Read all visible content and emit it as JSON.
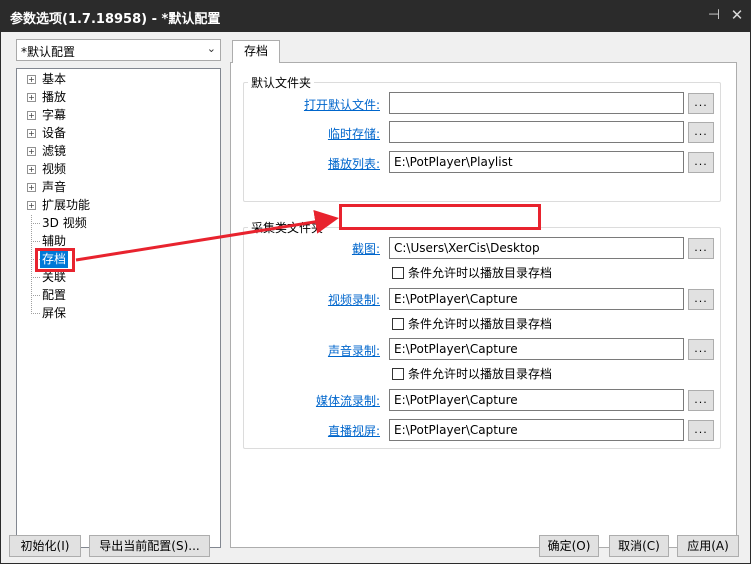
{
  "window": {
    "title": "参数选项(1.7.18958) - *默认配置",
    "pin_glyph": "⊣",
    "close_glyph": "✕"
  },
  "profile": {
    "selected": "*默认配置",
    "arrow_glyph": "⌄"
  },
  "tree": {
    "items": [
      {
        "label": "基本",
        "expandable": true
      },
      {
        "label": "播放",
        "expandable": true
      },
      {
        "label": "字幕",
        "expandable": true
      },
      {
        "label": "设备",
        "expandable": true
      },
      {
        "label": "滤镜",
        "expandable": true
      },
      {
        "label": "视频",
        "expandable": true
      },
      {
        "label": "声音",
        "expandable": true
      },
      {
        "label": "扩展功能",
        "expandable": true
      },
      {
        "label": "3D 视频",
        "expandable": false
      },
      {
        "label": "辅助",
        "expandable": false
      },
      {
        "label": "存档",
        "expandable": false,
        "selected": true
      },
      {
        "label": "关联",
        "expandable": false
      },
      {
        "label": "配置",
        "expandable": false
      },
      {
        "label": "屏保",
        "expandable": false
      }
    ],
    "expand_glyph": "+"
  },
  "tab": {
    "label": "存档"
  },
  "default_folders": {
    "title": "默认文件夹",
    "rows": [
      {
        "label": "打开默认文件:",
        "value": ""
      },
      {
        "label": "临时存储:",
        "value": ""
      },
      {
        "label": "播放列表:",
        "value": "E:\\PotPlayer\\Playlist"
      }
    ]
  },
  "capture_folders": {
    "title": "采集类文件夹",
    "rows": [
      {
        "label": "截图:",
        "value": "C:\\Users\\XerCis\\Desktop",
        "checkbox": "条件允许时以播放目录存档"
      },
      {
        "label": "视频录制:",
        "value": "E:\\PotPlayer\\Capture",
        "checkbox": "条件允许时以播放目录存档"
      },
      {
        "label": "声音录制:",
        "value": "E:\\PotPlayer\\Capture",
        "checkbox": "条件允许时以播放目录存档"
      },
      {
        "label": "媒体流录制:",
        "value": "E:\\PotPlayer\\Capture"
      },
      {
        "label": "直播视屏:",
        "value": "E:\\PotPlayer\\Capture"
      }
    ]
  },
  "browse_label": "...",
  "buttons": {
    "init": "初始化(I)",
    "export": "导出当前配置(S)...",
    "ok": "确定(O)",
    "cancel": "取消(C)",
    "apply": "应用(A)"
  },
  "colors": {
    "annotation_red": "#e8232e",
    "link_blue": "#0066cc"
  }
}
